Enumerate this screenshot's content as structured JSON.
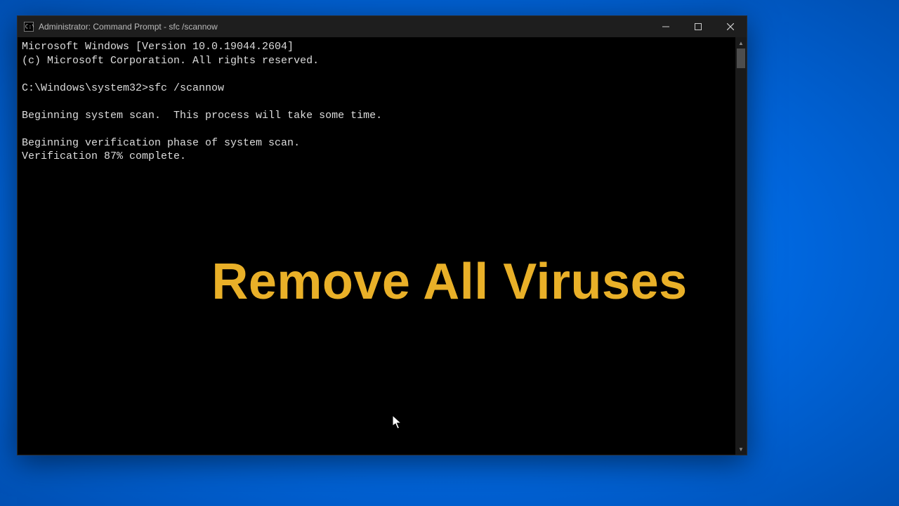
{
  "window": {
    "title": "Administrator: Command Prompt - sfc  /scannow"
  },
  "terminal": {
    "line0": "Microsoft Windows [Version 10.0.19044.2604]",
    "line1": "(c) Microsoft Corporation. All rights reserved.",
    "blank0": "",
    "promptPath": "C:\\Windows\\system32>",
    "command": "sfc /scannow",
    "blank1": "",
    "line2": "Beginning system scan.  This process will take some time.",
    "blank2": "",
    "line3": "Beginning verification phase of system scan.",
    "line4": "Verification 87% complete."
  },
  "overlay": {
    "headline": "Remove All Viruses"
  }
}
